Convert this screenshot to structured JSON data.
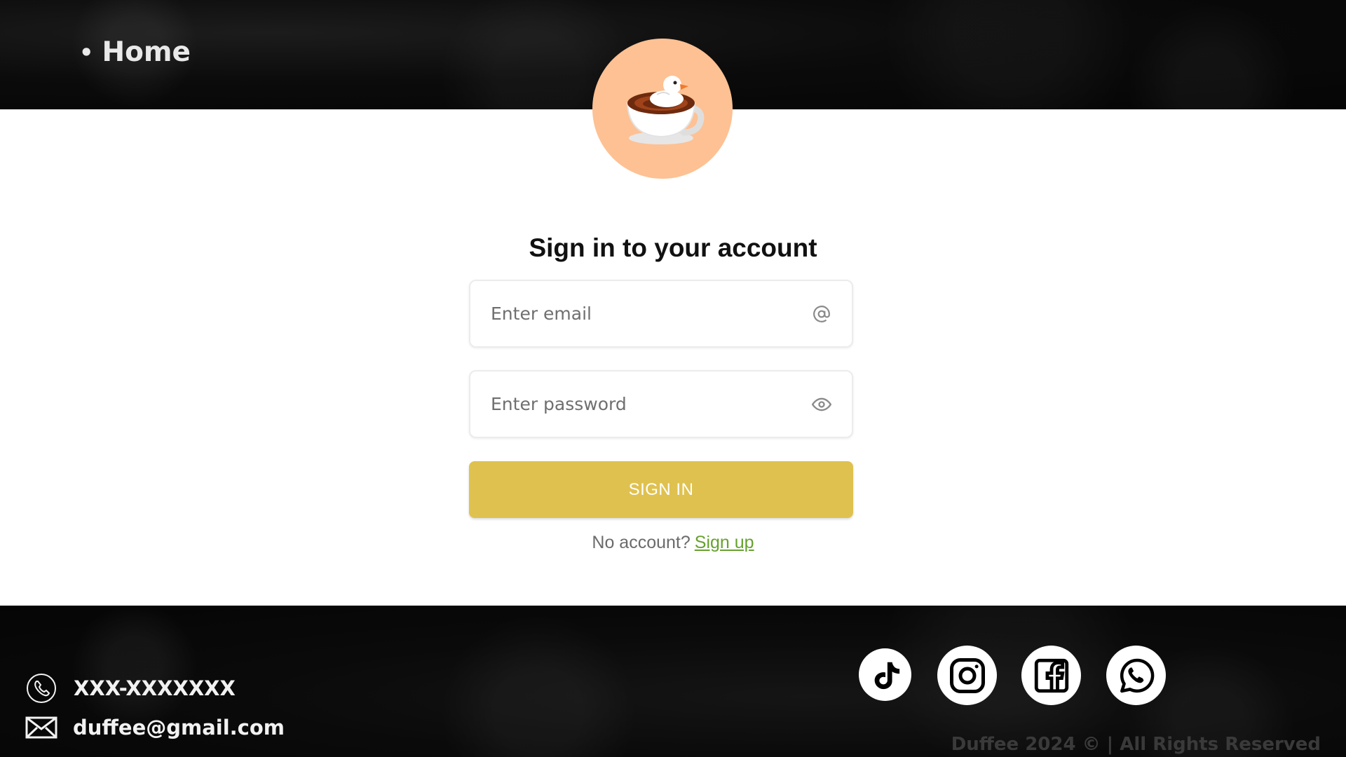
{
  "nav": {
    "home_bullet": "•",
    "home_label": "Home"
  },
  "logo": {
    "icon": "duck-coffee-cup-icon",
    "bg_color": "#fec193"
  },
  "form": {
    "title": "Sign in to your account",
    "email_placeholder": "Enter email",
    "email_icon": "at-sign-icon",
    "password_placeholder": "Enter password",
    "password_icon": "eye-icon",
    "submit_label": "SIGN IN",
    "submit_color": "#dfc14f",
    "signup_prompt": "No account?",
    "signup_link": "Sign up",
    "signup_link_color": "#66a12e"
  },
  "footer": {
    "phone_icon": "phone-icon",
    "phone": "XXX-XXXXXXX",
    "email_icon": "mail-icon",
    "email": "duffee@gmail.com",
    "social": [
      "tiktok-icon",
      "instagram-icon",
      "facebook-icon",
      "whatsapp-icon"
    ],
    "copyright": "Duffee 2024 © | All Rights Reserved"
  }
}
